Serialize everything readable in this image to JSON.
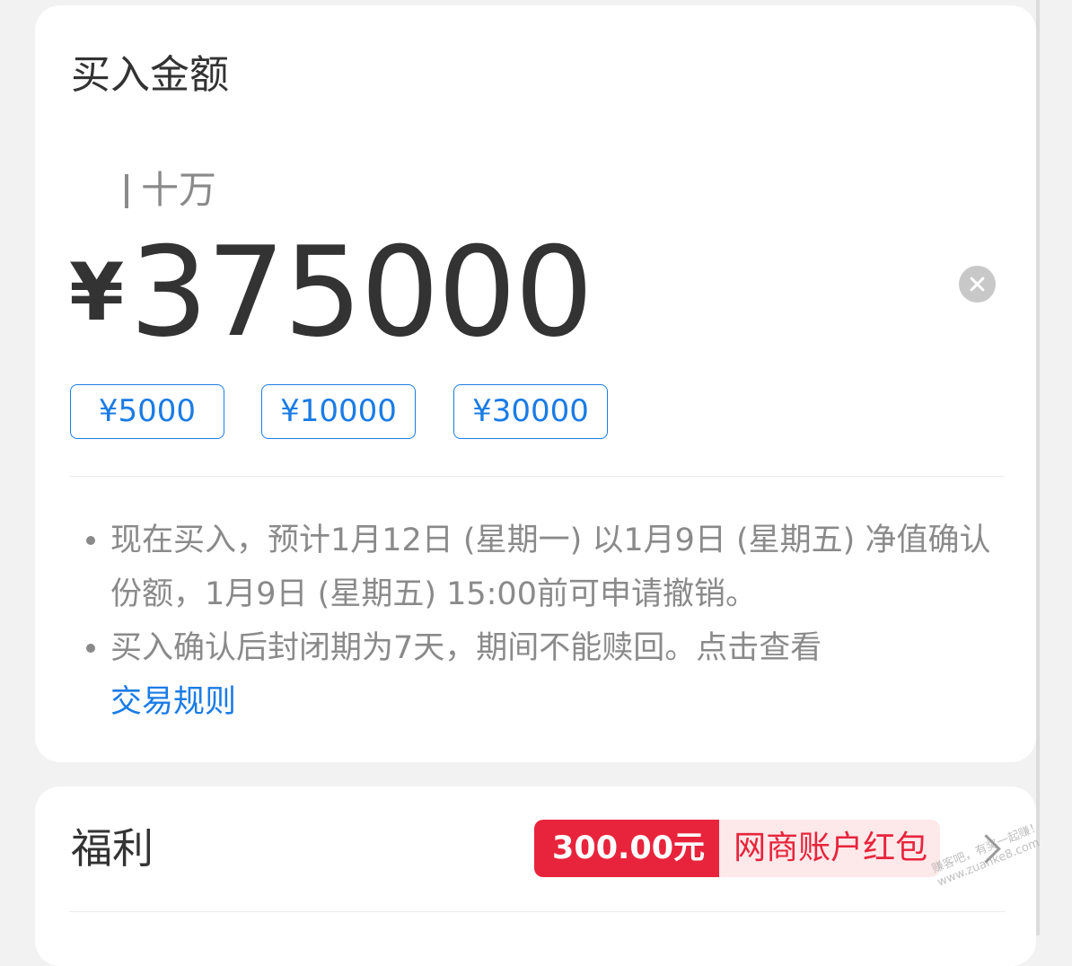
{
  "amount_card": {
    "title": "买入金额",
    "unit_hint": "十万",
    "currency_symbol": "¥",
    "amount": "375000",
    "quick_amounts": [
      "¥5000",
      "¥10000",
      "¥30000"
    ],
    "notes": {
      "first": "现在买入，预计1月12日 (星期一) 以1月9日 (星期五) 净值确认份额，1月9日 (星期五) 15:00前可申请撤销。",
      "second_text": "买入确认后封闭期为7天，期间不能赎回。点击查看",
      "second_link": "交易规则"
    }
  },
  "welfare_card": {
    "title": "福利",
    "reward_amount": "300.00元",
    "reward_label": "网商账户红包"
  },
  "icons": {
    "clear": "clear-circle-icon",
    "chevron": "chevron-right-icon"
  },
  "colors": {
    "accent_blue": "#1a7ce6",
    "reward_red": "#e8243c",
    "reward_pink_bg": "#fde9ea"
  }
}
